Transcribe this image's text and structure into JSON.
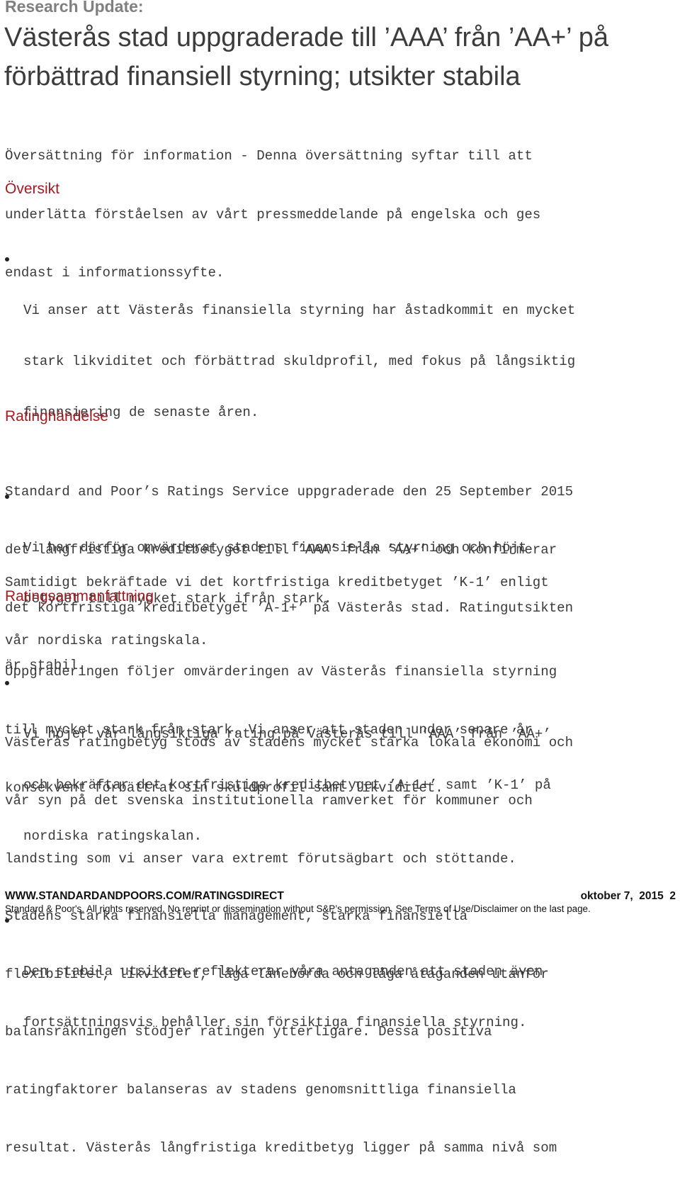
{
  "header": {
    "kicker": "Research Update:",
    "title": "Västerås stad uppgraderade till ’AAA’ från ’AA+’ på förbättrad finansiell styrning; utsikter stabila"
  },
  "intro": {
    "lines": [
      "Översättning för information - Denna översättning syftar till att",
      "underlätta förståelsen av vårt pressmeddelande på engelska och ges",
      "endast i informationssyfte."
    ]
  },
  "sections": {
    "oversikt": {
      "heading": "Översikt",
      "bullets": [
        {
          "lines": [
            "Vi anser att Västerås finansiella styrning har åstadkommit en mycket",
            "stark likviditet och förbättrad skuldprofil, med fokus på långsiktig",
            "finansiering de senaste åren."
          ]
        },
        {
          "lines": [
            "Vi har därför omvärderat stadens finansiella styrning och höjt",
            "betyget till mycket stark ifrån stark."
          ]
        },
        {
          "lines": [
            "Vi höjer vår långsiktiga rating på Västerås till ’AAA’ från ’AA+’",
            "och bekräftar det kortfristiga kreditbetyget ’A-1+’ samt ’K-1’ på",
            "nordiska ratingskalan."
          ]
        },
        {
          "lines": [
            "Den stabila utsikten reflekterar våra antaganden att staden även",
            "fortsättningsvis behåller sin försiktiga finansiella styrning."
          ]
        }
      ]
    },
    "ratinghandelse": {
      "heading": "Ratinghändelse",
      "paragraphs": [
        {
          "lines": [
            "Standard and Poor’s Ratings Service uppgraderade den 25 September 2015",
            "det långfristiga kreditbetyget till ’AAA’ från ’AA+’ och konfirmerar",
            "det kortfristiga kreditbetyget ’A-1+’ på Västerås stad. Ratingutsikten",
            "är stabil."
          ]
        },
        {
          "lines": [
            "Samtidigt bekräftade vi det kortfristiga kreditbetyget ’K-1’ enligt",
            "vår nordiska ratingskala."
          ]
        }
      ]
    },
    "ratingsammanfattning": {
      "heading": "Ratingsammanfattning",
      "paragraphs": [
        {
          "lines": [
            "Uppgraderingen följer omvärderingen av Västerås finansiella styrning",
            "till mycket stark från stark. Vi anser att staden under senare år",
            "konsekvent förbättrat sin skuldprofil samt likviditet."
          ]
        },
        {
          "lines": [
            "Västerås ratingbetyg stöds av stadens mycket starka lokala ekonomi och",
            "vår syn på det svenska institutionella ramverket för kommuner och",
            "landsting som vi anser vara extremt förutsägbart och stöttande.",
            "Stadens starka finansiella management, starka finansiella",
            "flexibilitet, likviditet, låga lånebörda och låga åtaganden utanför",
            "balansräkningen stödjer ratingen ytterligare. Dessa positiva",
            "ratingfaktorer balanseras av stadens genomsnittliga finansiella",
            "resultat. Västerås långfristiga kreditbetyg ligger på samma nivå som"
          ]
        }
      ]
    }
  },
  "footer": {
    "url": "WWW.STANDARDANDPOORS.COM/RATINGSDIRECT",
    "date": "oktober 7,  2015",
    "page_number": "2",
    "legal": "Standard & Poor's. All rights reserved. No reprint or dissemination without S&P’s permission. See Terms of Use/Disclaimer on the last page."
  },
  "colors": {
    "heading_red": "#a31b20",
    "kicker_gray": "#808080",
    "body_text": "#3a3a3a"
  }
}
